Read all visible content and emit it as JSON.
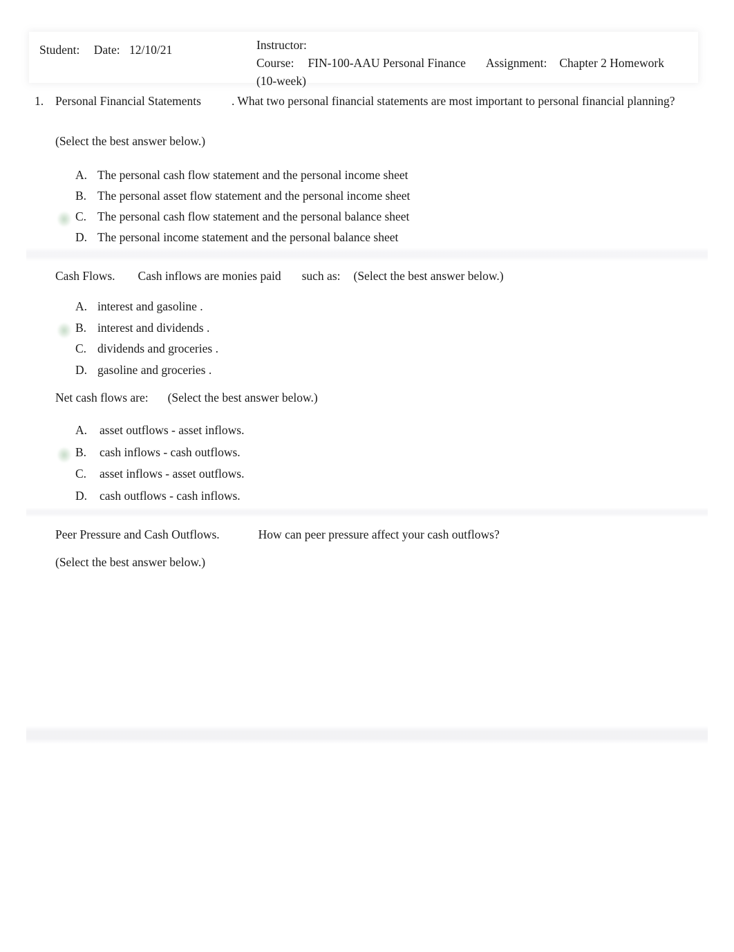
{
  "header": {
    "student_label": "Student:",
    "student_value": "",
    "date_label": "Date:",
    "date_value": "12/10/21",
    "instructor_label": "Instructor:",
    "instructor_value": "",
    "course_label": "Course:",
    "course_value": "FIN-100-AAU Personal Finance (10-week)",
    "course_value_line1": "FIN-100-AAU Personal Finance",
    "course_value_line2": "(10-week)",
    "assignment_label": "Assignment:",
    "assignment_value": "Chapter 2 Homework"
  },
  "question": {
    "number": "1.",
    "title": "Personal Financial Statements",
    "prompt": ". What two personal financial statements are most important to personal financial planning?",
    "select_note": "(Select the best answer below.)",
    "options": [
      {
        "letter": "A.",
        "text": "The personal cash flow statement and the personal income sheet",
        "selected": false
      },
      {
        "letter": "B.",
        "text": "The personal asset flow statement and the personal income sheet",
        "selected": false
      },
      {
        "letter": "C.",
        "text": "The personal cash flow statement and the personal balance sheet",
        "selected": true
      },
      {
        "letter": "D.",
        "text": "The personal income statement and the personal balance sheet",
        "selected": false
      }
    ]
  },
  "section_cash_flows": {
    "title": "Cash Flows.",
    "prompt_a": "Cash  inflows  are monies paid",
    "prompt_b": "such as:",
    "select_note": "(Select the best answer below.)",
    "options": [
      {
        "letter": "A.",
        "text": "interest  and  gasoline  .",
        "selected": false
      },
      {
        "letter": "B.",
        "text": "interest  and  dividends .",
        "selected": true
      },
      {
        "letter": "C.",
        "text": "dividends  and  groceries  .",
        "selected": false
      },
      {
        "letter": "D.",
        "text": "gasoline   and  groceries  .",
        "selected": false
      }
    ]
  },
  "section_net_cash_flows": {
    "prompt": "Net cash flows are:",
    "select_note": "(Select the best answer below.)",
    "options": [
      {
        "letter": "A.",
        "text": "asset outflows   -  asset inflows.",
        "selected": false
      },
      {
        "letter": "B.",
        "text": "cash inflows  -  cash outflows.",
        "selected": true
      },
      {
        "letter": "C.",
        "text": "asset inflows   -  asset outflows.",
        "selected": false
      },
      {
        "letter": "D.",
        "text": "cash outflows   -  cash inflows.",
        "selected": false
      }
    ]
  },
  "section_peer_pressure": {
    "title": "Peer Pressure and Cash Outflows.",
    "prompt": "How can peer pressure affect your cash outflows?",
    "select_note": "(Select the best answer below.)"
  }
}
